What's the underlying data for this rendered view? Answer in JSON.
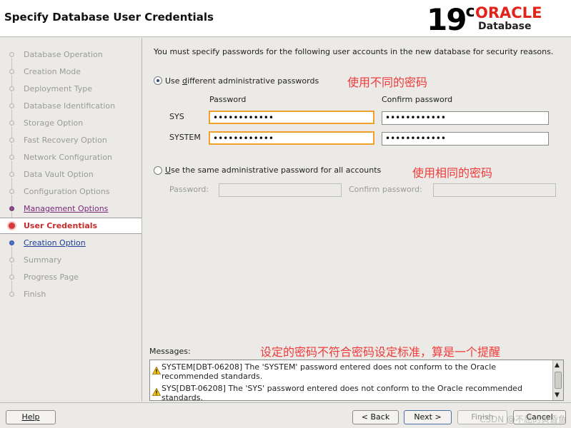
{
  "header": {
    "title": "Specify Database User Credentials",
    "logo": {
      "version": "19",
      "version_suffix": "c",
      "brand": "ORACLE",
      "product": "Database"
    }
  },
  "steps": [
    {
      "label": "Database Operation",
      "state": "done"
    },
    {
      "label": "Creation Mode",
      "state": "done"
    },
    {
      "label": "Deployment Type",
      "state": "done"
    },
    {
      "label": "Database Identification",
      "state": "done"
    },
    {
      "label": "Storage Option",
      "state": "done"
    },
    {
      "label": "Fast Recovery Option",
      "state": "done"
    },
    {
      "label": "Network Configuration",
      "state": "done"
    },
    {
      "label": "Data Vault Option",
      "state": "done"
    },
    {
      "label": "Configuration Options",
      "state": "done"
    },
    {
      "label": "Management Options",
      "state": "visited"
    },
    {
      "label": "User Credentials",
      "state": "current"
    },
    {
      "label": "Creation Option",
      "state": "next"
    },
    {
      "label": "Summary",
      "state": "future"
    },
    {
      "label": "Progress Page",
      "state": "future"
    },
    {
      "label": "Finish",
      "state": "future"
    }
  ],
  "content": {
    "intro": "You must specify passwords for the following user accounts in the new database for security reasons.",
    "option_different": {
      "pre": "Use ",
      "mnemonic": "d",
      "post": "ifferent administrative passwords",
      "selected": true
    },
    "annotation_different": "使用不同的密码",
    "col_password": "Password",
    "col_confirm": "Confirm password",
    "rows": [
      {
        "label": "SYS",
        "password": "••••••••••••",
        "confirm": "••••••••••••"
      },
      {
        "label": "SYSTEM",
        "password": "••••••••••••",
        "confirm": "••••••••••••"
      }
    ],
    "option_same": {
      "pre": "",
      "mnemonic": "U",
      "post": "se the same administrative password for all accounts",
      "selected": false
    },
    "annotation_same": "使用相同的密码",
    "same_password_label": "Password:",
    "same_confirm_label": "Confirm password:",
    "messages_label": "Messages:",
    "annotation_messages": "设定的密码不符合密码设定标准，算是一个提醒",
    "messages": [
      "SYSTEM[DBT-06208] The 'SYSTEM' password entered does not conform to the Oracle recommended standards.",
      "SYS[DBT-06208] The 'SYS' password entered does not conform to the Oracle recommended standards."
    ]
  },
  "footer": {
    "help": "Help",
    "back": "< Back",
    "next": "Next >",
    "finish": "Finish",
    "cancel": "Cancel"
  },
  "watermark": "CSDN @不屈的黄昏鱼",
  "colors": {
    "oracle_red": "#e2231a",
    "annotation": "#ef3b3b",
    "warning_border": "#f2a02c"
  }
}
